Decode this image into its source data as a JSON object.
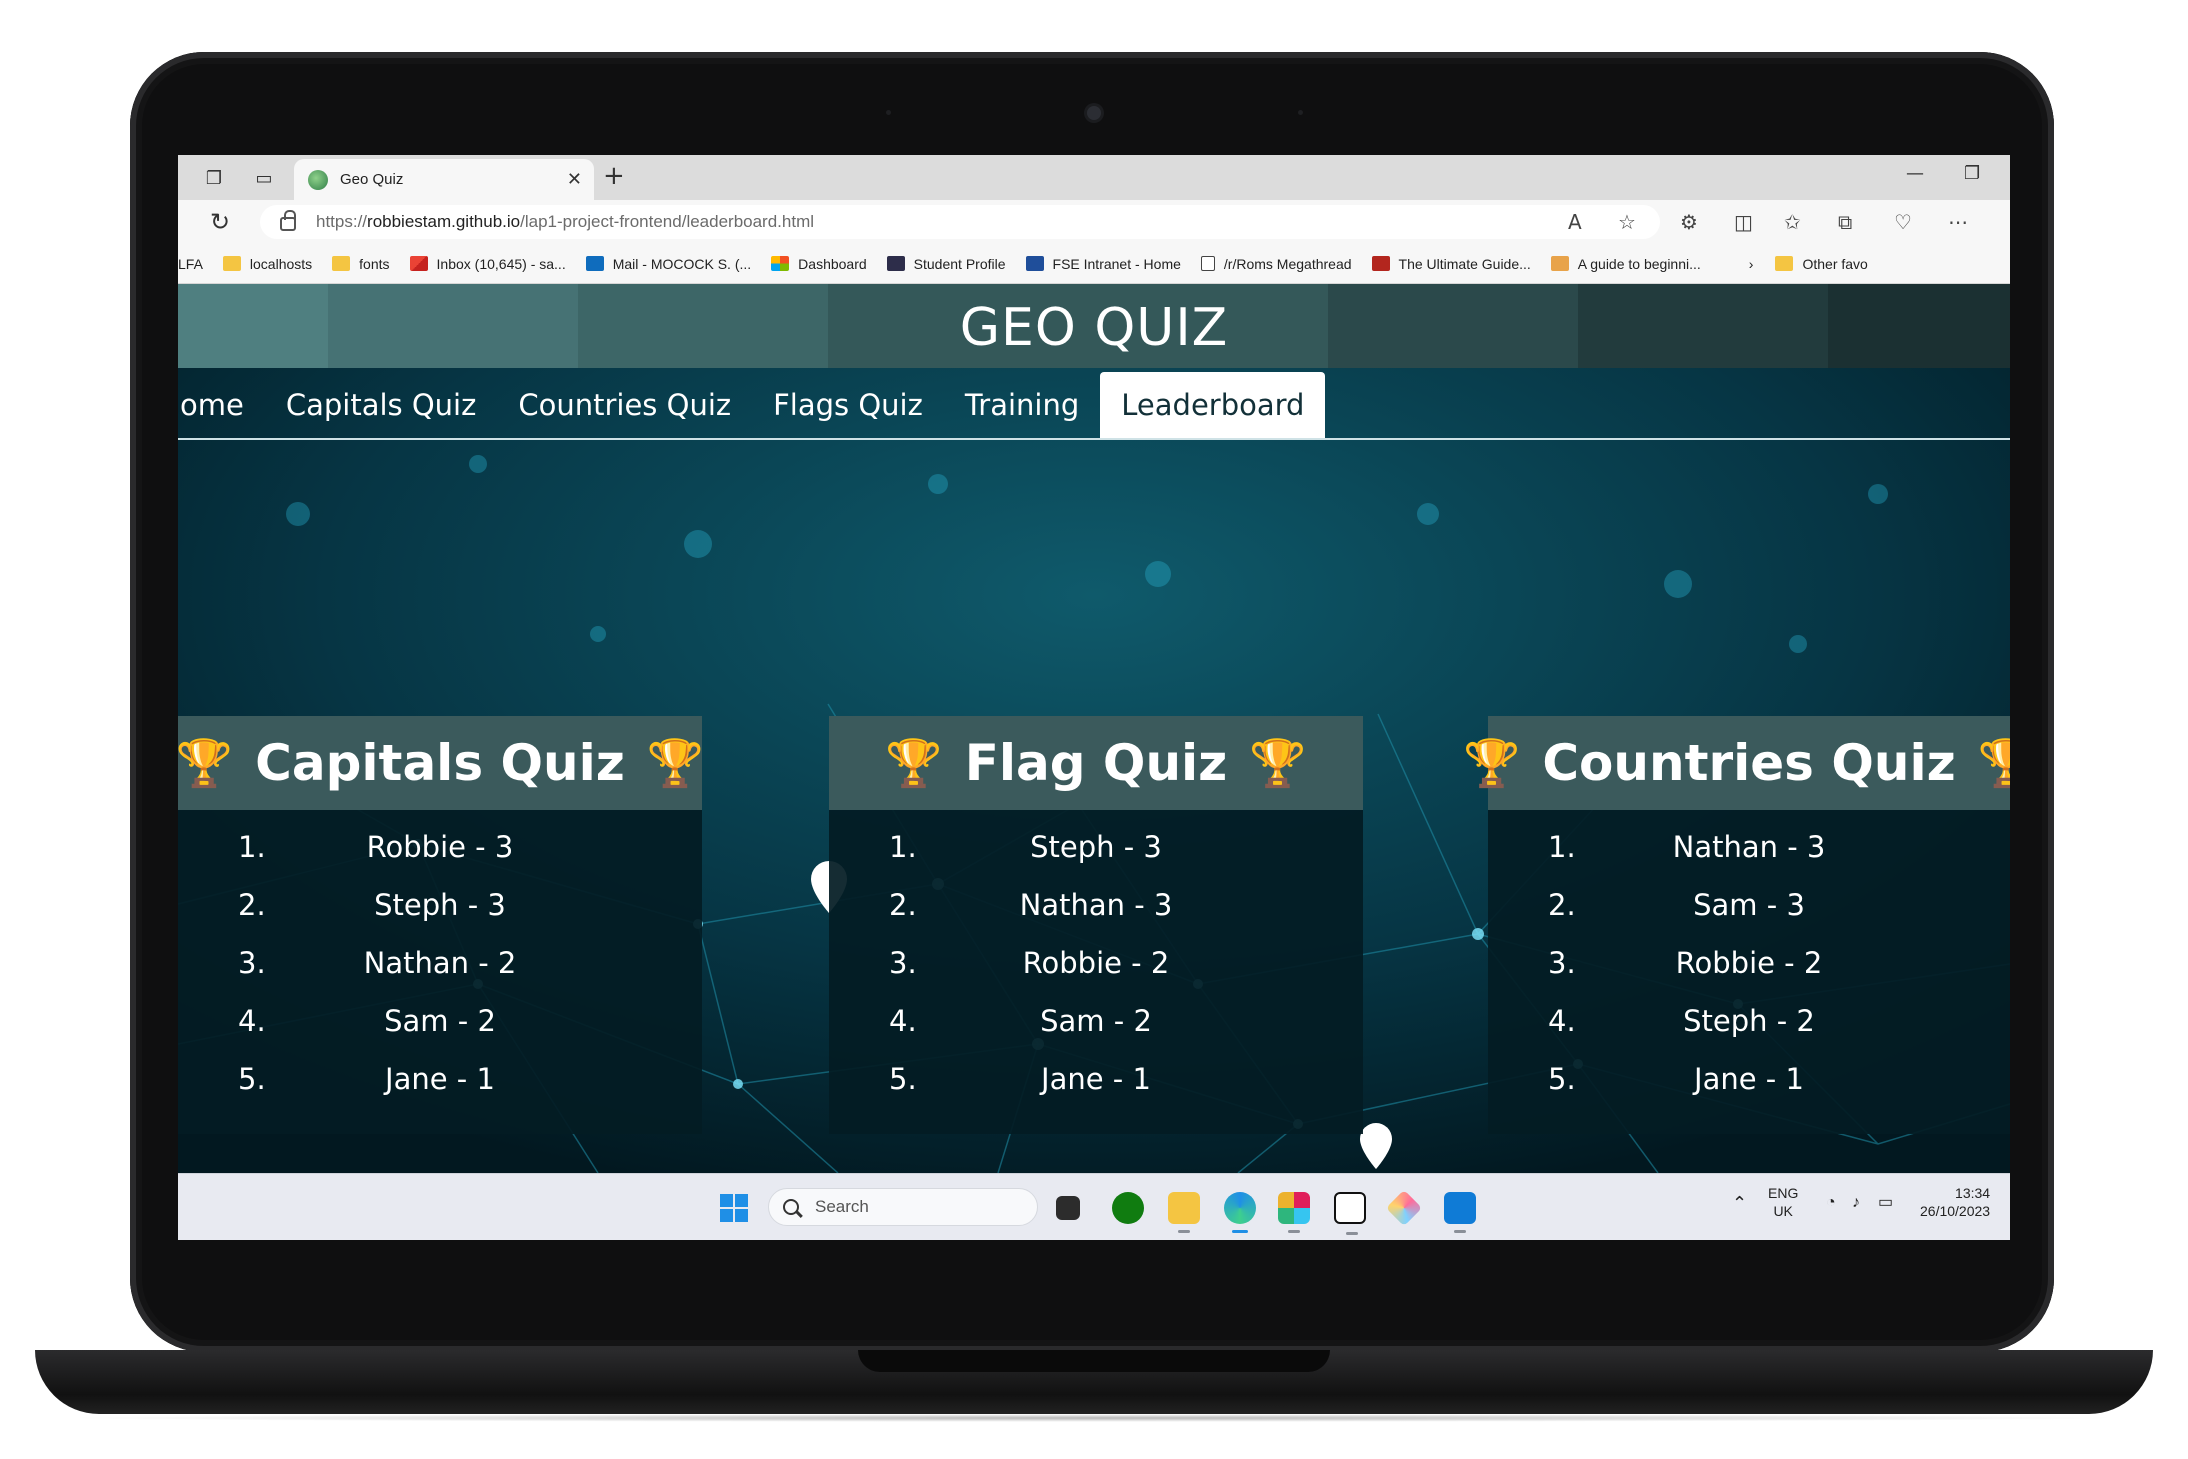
{
  "browser": {
    "tab_title": "Geo Quiz",
    "url_prefix": "https://",
    "url_domain": "robbiestam.github.io",
    "url_path": "/lap1-project-frontend/leaderboard.html",
    "bookmarks": [
      {
        "label": "LFA",
        "icon": "none"
      },
      {
        "label": "localhosts",
        "icon": "folder"
      },
      {
        "label": "fonts",
        "icon": "folder"
      },
      {
        "label": "Inbox (10,645) - sa...",
        "icon": "gmail"
      },
      {
        "label": "Mail - MOCOCK S. (...",
        "icon": "outlook"
      },
      {
        "label": "Dashboard",
        "icon": "ms"
      },
      {
        "label": "Student Profile",
        "icon": "stud"
      },
      {
        "label": "FSE Intranet - Home",
        "icon": "fse"
      },
      {
        "label": "/r/Roms Megathread",
        "icon": "doc"
      },
      {
        "label": "The Ultimate Guide...",
        "icon": "mm"
      },
      {
        "label": "A guide to beginni...",
        "icon": "guide"
      }
    ],
    "other_favorites": "Other favo"
  },
  "site": {
    "title": "GEO QUIZ",
    "nav": [
      {
        "label": "ome",
        "active": false
      },
      {
        "label": "Capitals Quiz",
        "active": false
      },
      {
        "label": "Countries Quiz",
        "active": false
      },
      {
        "label": "Flags Quiz",
        "active": false
      },
      {
        "label": "Training",
        "active": false
      },
      {
        "label": "Leaderboard",
        "active": true
      }
    ]
  },
  "leaderboards": [
    {
      "title": "Capitals Quiz",
      "entries": [
        {
          "rank": "1.",
          "text": "Robbie - 3"
        },
        {
          "rank": "2.",
          "text": "Steph - 3"
        },
        {
          "rank": "3.",
          "text": "Nathan - 2"
        },
        {
          "rank": "4.",
          "text": "Sam - 2"
        },
        {
          "rank": "5.",
          "text": "Jane - 1"
        }
      ]
    },
    {
      "title": "Flag Quiz",
      "entries": [
        {
          "rank": "1.",
          "text": "Steph - 3"
        },
        {
          "rank": "2.",
          "text": "Nathan - 3"
        },
        {
          "rank": "3.",
          "text": "Robbie - 2"
        },
        {
          "rank": "4.",
          "text": "Sam - 2"
        },
        {
          "rank": "5.",
          "text": "Jane - 1"
        }
      ]
    },
    {
      "title": "Countries Quiz",
      "entries": [
        {
          "rank": "1.",
          "text": "Nathan - 3"
        },
        {
          "rank": "2.",
          "text": "Sam - 3"
        },
        {
          "rank": "3.",
          "text": "Robbie - 2"
        },
        {
          "rank": "4.",
          "text": "Steph - 2"
        },
        {
          "rank": "5.",
          "text": "Jane - 1"
        }
      ]
    }
  ],
  "taskbar": {
    "search_label": "Search",
    "lang_top": "ENG",
    "lang_bottom": "UK",
    "time": "13:34",
    "date": "26/10/2023"
  },
  "colors": {
    "header_teal": "#4f7f80",
    "panel_head": "#3b5a5c",
    "trophy": "#e6a020",
    "accent_blue": "#1f8fe6"
  }
}
